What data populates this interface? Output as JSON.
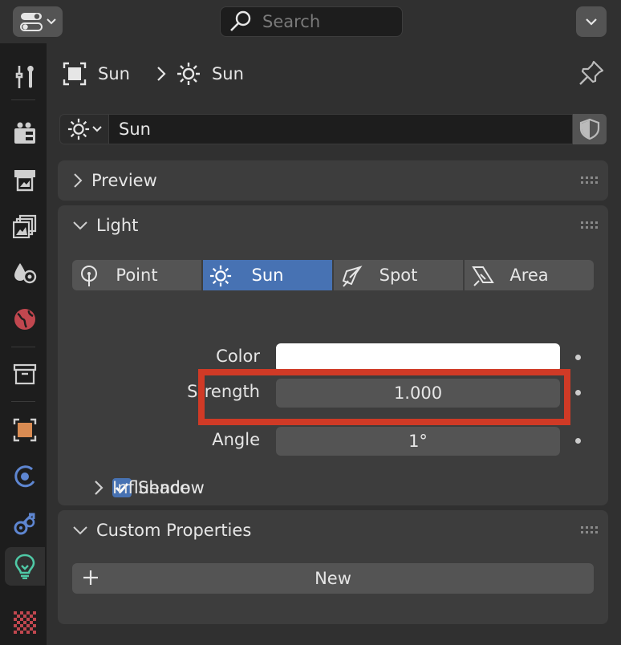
{
  "header": {
    "search_placeholder": "Search"
  },
  "sidebar": {
    "tabs": [
      {
        "name": "tool-icon"
      },
      {
        "name": "render-icon"
      },
      {
        "name": "output-icon"
      },
      {
        "name": "view-layer-icon"
      },
      {
        "name": "scene-icon"
      },
      {
        "name": "world-icon"
      },
      {
        "name": "collection-icon"
      },
      {
        "name": "object-icon"
      },
      {
        "name": "physics-icon"
      },
      {
        "name": "constraints-icon"
      },
      {
        "name": "light-data-icon",
        "active": true
      },
      {
        "name": "texture-icon"
      }
    ]
  },
  "breadcrumb": {
    "object": "Sun",
    "data": "Sun"
  },
  "datablock": {
    "name": "Sun"
  },
  "panels": {
    "preview": {
      "title": "Preview"
    },
    "light": {
      "title": "Light",
      "types": [
        {
          "label": "Point",
          "icon": "point-light-icon"
        },
        {
          "label": "Sun",
          "icon": "sun-light-icon",
          "active": true
        },
        {
          "label": "Spot",
          "icon": "spot-light-icon"
        },
        {
          "label": "Area",
          "icon": "area-light-icon"
        }
      ],
      "color_label": "Color",
      "color_value": "#ffffff",
      "strength_label": "Strength",
      "strength_value": "1.000",
      "angle_label": "Angle",
      "angle_value": "1°",
      "shadow_label": "Shadow",
      "shadow_checked": true,
      "influence_label": "Influence"
    },
    "custom_properties": {
      "title": "Custom Properties",
      "new_label": "New"
    }
  },
  "colors": {
    "accent": "#4772b3",
    "highlight": "#d03a26"
  }
}
